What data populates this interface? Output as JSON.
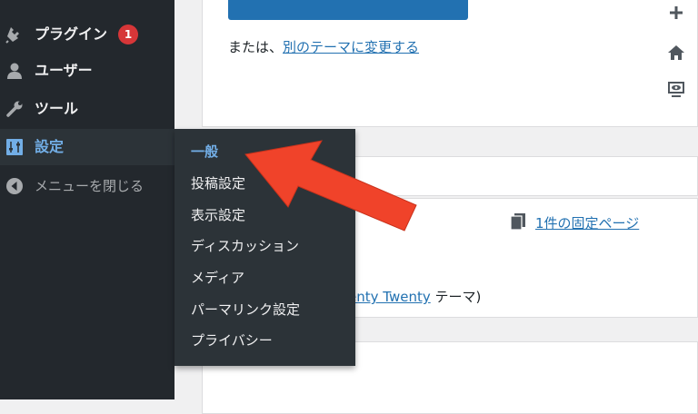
{
  "sidebar": {
    "items": [
      {
        "id": "plugins",
        "label": "プラグイン",
        "icon": "plugin-icon",
        "badge": "1"
      },
      {
        "id": "users",
        "label": "ユーザー",
        "icon": "user-icon"
      },
      {
        "id": "tools",
        "label": "ツール",
        "icon": "wrench-icon"
      },
      {
        "id": "settings",
        "label": "設定",
        "icon": "settings-sliders-icon"
      },
      {
        "id": "collapse",
        "label": "メニューを閉じる",
        "icon": "collapse-arrow-icon"
      }
    ]
  },
  "submenu": {
    "items": [
      "一般",
      "投稿設定",
      "表示設定",
      "ディスカッション",
      "メディア",
      "パーマリンク設定",
      "プライバシー"
    ],
    "active_index": 0
  },
  "main": {
    "theme_change_prefix": "または、",
    "theme_change_link": "別のテーマに変更する",
    "pages_count_link": "1件の固定ページ",
    "theme_link": "enty Twenty",
    "theme_suffix": " テーマ)",
    "icons": [
      "plus-icon",
      "home-icon",
      "preview-screen-icon",
      "page-icon"
    ]
  },
  "colors": {
    "sidebar_bg": "#23282d",
    "submenu_bg": "#2c3338",
    "accent": "#72aee6",
    "link": "#2271b1",
    "badge": "#d63638",
    "arrow": "#f0432a"
  }
}
